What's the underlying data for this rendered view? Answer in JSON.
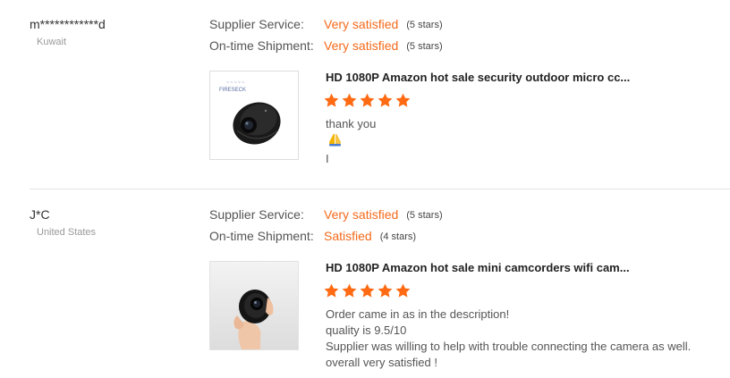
{
  "reviews": [
    {
      "buyer": "m************d",
      "country": "Kuwait",
      "supplier_service_label": "Supplier Service:",
      "supplier_service_value": "Very satisfied",
      "supplier_service_stars": "(5 stars)",
      "shipment_label": "On-time Shipment:",
      "shipment_value": "Very satisfied",
      "shipment_stars": "(5 stars)",
      "product_title": "HD 1080P Amazon hot sale security outdoor micro cc...",
      "product_rating": 5,
      "thumb_brand": "FIRESECK",
      "text_before_icon": "thank you",
      "text_icon": "folded-hands-icon",
      "text_after_icon": "I"
    },
    {
      "buyer": "J*C",
      "country": "United States",
      "supplier_service_label": "Supplier Service:",
      "supplier_service_value": "Very satisfied",
      "supplier_service_stars": "(5 stars)",
      "shipment_label": "On-time Shipment:",
      "shipment_value": "Satisfied",
      "shipment_stars": "(4 stars)",
      "product_title": "HD 1080P Amazon hot sale mini camcorders wifi cam...",
      "product_rating": 5,
      "text_lines": [
        "Order came in as in the description!",
        "quality is 9.5/10",
        "Supplier was willing to help with trouble connecting the camera as well.",
        "overall very satisfied !"
      ]
    }
  ],
  "colors": {
    "accent_orange": "#f56a1b",
    "star_orange": "#ff6a13",
    "divider": "#e4e4e4"
  }
}
